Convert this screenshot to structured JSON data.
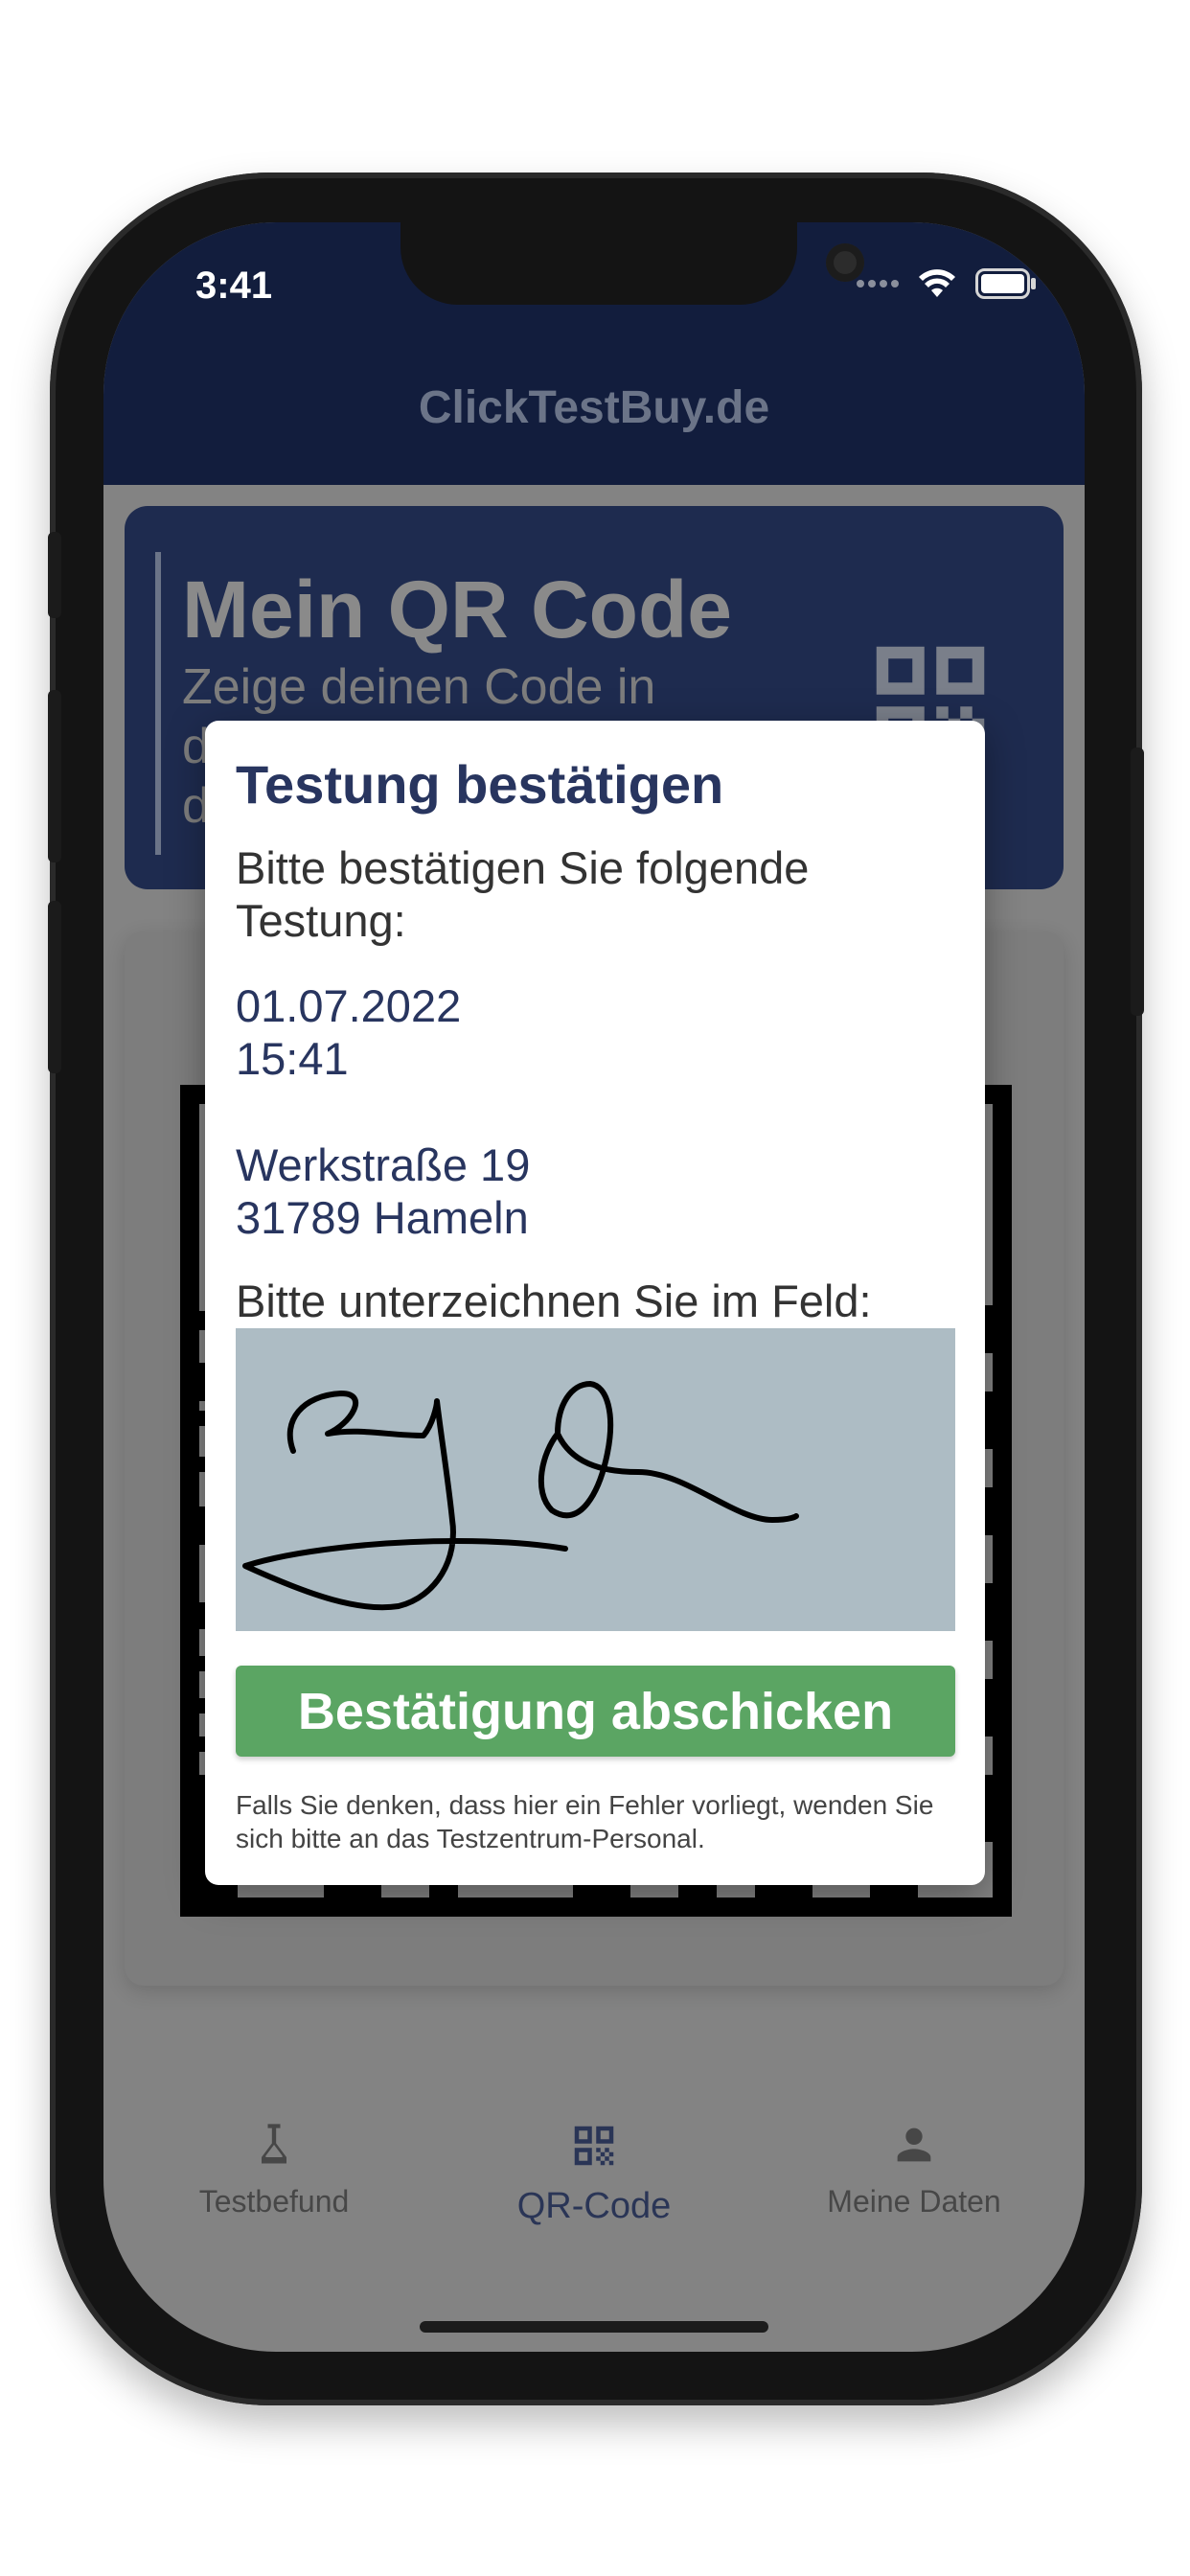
{
  "status_bar": {
    "time": "3:41",
    "icons": [
      "signal-dots-icon",
      "wifi-icon",
      "battery-icon"
    ]
  },
  "app": {
    "title": "ClickTestBuy.de"
  },
  "banner": {
    "title": "Mein QR Code",
    "subtitle_visible": "Zeige deinen Code in",
    "subtitle_line2_fragment": "d",
    "subtitle_line3_fragment": "d"
  },
  "dialog": {
    "title": "Testung bestätigen",
    "intro": "Bitte bestätigen Sie folgende Testung:",
    "date": "01.07.2022",
    "time": "15:41",
    "street": "Werkstraße 19",
    "city": "31789 Hameln",
    "sign_label": "Bitte unterzeichnen Sie im Feld:",
    "submit_label": "Bestätigung abschicken",
    "footnote": "Falls Sie denken, dass hier ein Fehler vorliegt, wenden Sie sich bitte an das Testzentrum-Personal."
  },
  "tabs": [
    {
      "label": "Testbefund",
      "icon": "microscope-icon",
      "active": false
    },
    {
      "label": "QR-Code",
      "icon": "qr-code-icon",
      "active": true
    },
    {
      "label": "Meine Daten",
      "icon": "person-icon",
      "active": false
    }
  ],
  "colors": {
    "header": "#121d3d",
    "dialog_title": "#28355f",
    "submit_button": "#5ba563",
    "signature_pad": "#adbcc4",
    "overlay": "#838383"
  }
}
